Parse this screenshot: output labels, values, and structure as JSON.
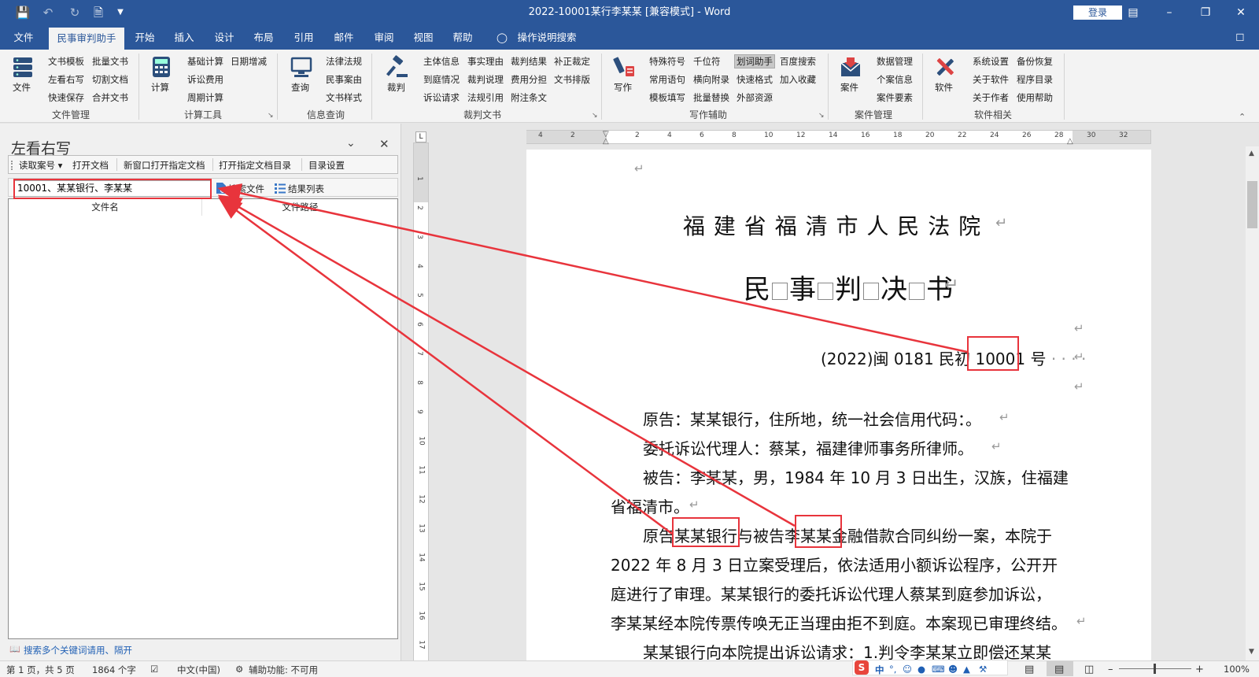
{
  "window": {
    "title": "2022-10001某行李某某 [兼容模式]  -  Word",
    "login": "登录"
  },
  "tabs": [
    {
      "label": "文件",
      "active": false
    },
    {
      "label": "民事审判助手",
      "active": true
    },
    {
      "label": "开始",
      "active": false
    },
    {
      "label": "插入",
      "active": false
    },
    {
      "label": "设计",
      "active": false
    },
    {
      "label": "布局",
      "active": false
    },
    {
      "label": "引用",
      "active": false
    },
    {
      "label": "邮件",
      "active": false
    },
    {
      "label": "审阅",
      "active": false
    },
    {
      "label": "视图",
      "active": false
    },
    {
      "label": "帮助",
      "active": false
    },
    {
      "label": "操作说明搜索",
      "active": false
    }
  ],
  "ribbon": {
    "wenjian": {
      "big": "文件",
      "items": [
        "文书模板",
        "批量文书",
        "左看右写",
        "切割文档",
        "快速保存",
        "合并文书"
      ],
      "group": "文件管理"
    },
    "jisuan": {
      "big": "计算",
      "items": [
        "基础计算",
        "日期增减",
        "诉讼费用",
        "周期计算"
      ],
      "group": "计算工具"
    },
    "chaxun": {
      "big": "查询",
      "items": [
        "法律法规",
        "民事案由",
        "文书样式"
      ],
      "group": "信息查询"
    },
    "caipan": {
      "big": "裁判",
      "items": [
        "主体信息",
        "事实理由",
        "裁判结果",
        "补正裁定",
        "到庭情况",
        "裁判说理",
        "费用分担",
        "文书排版",
        "诉讼请求",
        "法规引用",
        "附注条文"
      ],
      "group": "裁判文书"
    },
    "xiezuo": {
      "big": "写作",
      "items": [
        "特殊符号",
        "千位符",
        "划词助手",
        "百度搜索",
        "常用语句",
        "横向附录",
        "快速格式",
        "加入收藏",
        "模板填写",
        "批量替换",
        "外部资源"
      ],
      "group": "写作辅助"
    },
    "anjian": {
      "big": "案件",
      "items": [
        "数据管理",
        "个案信息",
        "案件要素"
      ],
      "group": "案件管理"
    },
    "ruanjian": {
      "big": "软件",
      "items": [
        "系统设置",
        "备份恢复",
        "关于软件",
        "程序目录",
        "关于作者",
        "使用帮助"
      ],
      "group": "软件相关"
    }
  },
  "pane": {
    "title": "左看右写",
    "toolbar1": [
      "读取案号 ▾",
      "打开文档",
      "新窗口打开指定文档",
      "打开指定文档目录",
      "目录设置"
    ],
    "search_value": "10001、某某银行、李某某",
    "search_btn": "搜索文件",
    "list_btn": "结果列表",
    "col1": "文件名",
    "col2": "文件路径",
    "hint": "搜索多个关键词请用、隔开"
  },
  "doc": {
    "court": "福 建 省 福 清 市 人 民 法 院",
    "doctype": [
      "民",
      "事",
      "判",
      "决",
      "书"
    ],
    "case_prefix": "(2022)闽 0181 民初 ",
    "case_num": "10001",
    "case_suffix": " 号",
    "p1": "原告：某某银行，住所地，统一社会信用代码：。",
    "p2": "委托诉讼代理人：蔡某，福建律师事务所律师。",
    "p3a": "被告：李某某，男，1984 年 10 月 3 日出生，汉族，住福建",
    "p3b": "省福清市。",
    "p4_1": "原告",
    "p4_2": "某某银行",
    "p4_3": "与被告",
    "p4_4": "李某某",
    "p4_5": "金融借款合同纠纷一案，本院于",
    "p4b": "2022 年 8 月 3 日立案受理后，依法适用小额诉讼程序，公开开",
    "p4c": "庭进行了审理。某某银行的委托诉讼代理人蔡某到庭参加诉讼，",
    "p4d": "李某某经本院传票传唤无正当理由拒不到庭。本案现已审理终结。",
    "p5": "某某银行向本院提出诉讼请求：1.判令李某某立即偿还某某"
  },
  "ruler": {
    "h": [
      "4",
      "2",
      "",
      "2",
      "4",
      "6",
      "8",
      "10",
      "12",
      "14",
      "16",
      "18",
      "20",
      "22",
      "24",
      "26",
      "28",
      "30",
      "32"
    ],
    "v": [
      "1",
      "2",
      "3",
      "4",
      "5",
      "6",
      "7",
      "8",
      "9",
      "10",
      "11",
      "12",
      "13",
      "14",
      "15",
      "16",
      "17"
    ]
  },
  "status": {
    "page": "第 1 页，共 5 页",
    "words": "1864 个字",
    "lang": "中文(中国)",
    "access": "辅助功能: 不可用",
    "zoom": "100%",
    "ime": "中"
  }
}
